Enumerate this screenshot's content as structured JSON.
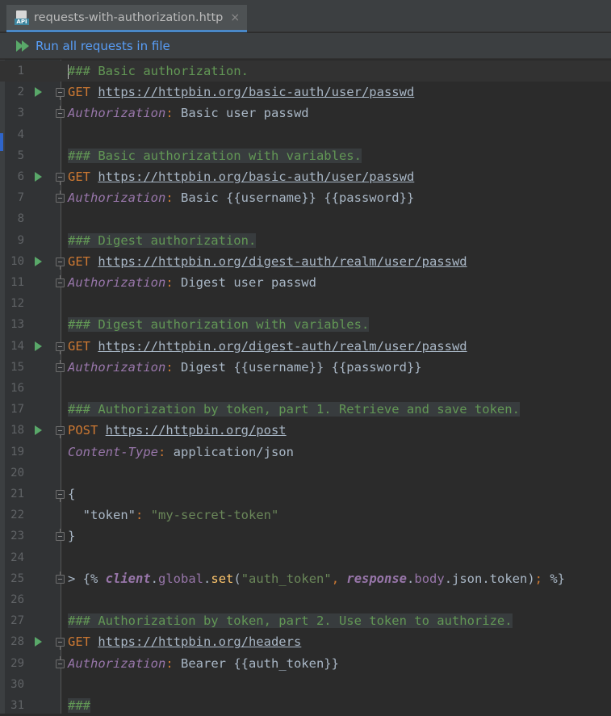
{
  "tab": {
    "title": "requests-with-authorization.http",
    "icon_badge": "API",
    "close_symbol": "×"
  },
  "toolbar": {
    "run_all_label": "Run all requests in file"
  },
  "lines": [
    {
      "n": "1",
      "parts": [
        [
          "c",
          "### Basic authorization."
        ]
      ],
      "comment_bg": false,
      "current": true
    },
    {
      "n": "2",
      "run": true,
      "fold": "open",
      "parts": [
        [
          "m",
          "GET"
        ],
        [
          "p",
          " "
        ],
        [
          "u",
          "https://httpbin.org/basic-auth/user/passwd"
        ]
      ]
    },
    {
      "n": "3",
      "fold": "end",
      "parts": [
        [
          "h",
          "Authorization"
        ],
        [
          "o",
          ":"
        ],
        [
          "p",
          " Basic user passwd"
        ]
      ]
    },
    {
      "n": "4",
      "parts": []
    },
    {
      "n": "5",
      "parts": [
        [
          "c",
          "### Basic authorization with variables."
        ]
      ],
      "comment_bg": true
    },
    {
      "n": "6",
      "run": true,
      "fold": "open",
      "parts": [
        [
          "m",
          "GET"
        ],
        [
          "p",
          " "
        ],
        [
          "u",
          "https://httpbin.org/basic-auth/user/passwd"
        ]
      ]
    },
    {
      "n": "7",
      "fold": "end",
      "parts": [
        [
          "h",
          "Authorization"
        ],
        [
          "o",
          ":"
        ],
        [
          "p",
          " Basic {{username}} {{password}}"
        ]
      ]
    },
    {
      "n": "8",
      "parts": []
    },
    {
      "n": "9",
      "parts": [
        [
          "c",
          "### Digest authorization."
        ]
      ],
      "comment_bg": true
    },
    {
      "n": "10",
      "run": true,
      "fold": "open",
      "parts": [
        [
          "m",
          "GET"
        ],
        [
          "p",
          " "
        ],
        [
          "u",
          "https://httpbin.org/digest-auth/realm/user/passwd"
        ]
      ]
    },
    {
      "n": "11",
      "fold": "end",
      "parts": [
        [
          "h",
          "Authorization"
        ],
        [
          "o",
          ":"
        ],
        [
          "p",
          " Digest user passwd"
        ]
      ]
    },
    {
      "n": "12",
      "parts": []
    },
    {
      "n": "13",
      "parts": [
        [
          "c",
          "### Digest authorization with variables."
        ]
      ],
      "comment_bg": true
    },
    {
      "n": "14",
      "run": true,
      "fold": "open",
      "parts": [
        [
          "m",
          "GET"
        ],
        [
          "p",
          " "
        ],
        [
          "u",
          "https://httpbin.org/digest-auth/realm/user/passwd"
        ]
      ]
    },
    {
      "n": "15",
      "fold": "end",
      "parts": [
        [
          "h",
          "Authorization"
        ],
        [
          "o",
          ":"
        ],
        [
          "p",
          " Digest {{username}} {{password}}"
        ]
      ]
    },
    {
      "n": "16",
      "parts": []
    },
    {
      "n": "17",
      "parts": [
        [
          "c",
          "### Authorization by token, part 1. Retrieve and save token."
        ]
      ],
      "comment_bg": true
    },
    {
      "n": "18",
      "run": true,
      "fold": "open",
      "parts": [
        [
          "m",
          "POST"
        ],
        [
          "p",
          " "
        ],
        [
          "u",
          "https://httpbin.org/post"
        ]
      ]
    },
    {
      "n": "19",
      "parts": [
        [
          "h",
          "Content-Type"
        ],
        [
          "o",
          ":"
        ],
        [
          "p",
          " application/json"
        ]
      ]
    },
    {
      "n": "20",
      "parts": []
    },
    {
      "n": "21",
      "fold": "open",
      "parts": [
        [
          "p",
          "{"
        ]
      ]
    },
    {
      "n": "22",
      "parts": [
        [
          "p",
          "  "
        ],
        [
          "k",
          "\"token\""
        ],
        [
          "o",
          ":"
        ],
        [
          "p",
          " "
        ],
        [
          "s",
          "\"my-secret-token\""
        ]
      ]
    },
    {
      "n": "23",
      "fold": "end",
      "parts": [
        [
          "p",
          "}"
        ]
      ]
    },
    {
      "n": "24",
      "parts": []
    },
    {
      "n": "25",
      "fold": "end",
      "parts": [
        [
          "p",
          "> {% "
        ],
        [
          "i",
          "client"
        ],
        [
          "p",
          "."
        ],
        [
          "v",
          "global"
        ],
        [
          "p",
          "."
        ],
        [
          "f",
          "set"
        ],
        [
          "p",
          "("
        ],
        [
          "s",
          "\"auth_token\""
        ],
        [
          "o",
          ", "
        ],
        [
          "i",
          "response"
        ],
        [
          "p",
          "."
        ],
        [
          "v",
          "body"
        ],
        [
          "p",
          ".json.token)"
        ],
        [
          "o",
          ";"
        ],
        [
          "p",
          " %}"
        ]
      ]
    },
    {
      "n": "26",
      "parts": []
    },
    {
      "n": "27",
      "parts": [
        [
          "c",
          "### Authorization by token, part 2. Use token to authorize."
        ]
      ],
      "comment_bg": true
    },
    {
      "n": "28",
      "run": true,
      "fold": "open",
      "parts": [
        [
          "m",
          "GET"
        ],
        [
          "p",
          " "
        ],
        [
          "u",
          "https://httpbin.org/headers"
        ]
      ]
    },
    {
      "n": "29",
      "fold": "end",
      "parts": [
        [
          "h",
          "Authorization"
        ],
        [
          "o",
          ":"
        ],
        [
          "p",
          " Bearer {{auth_token}}"
        ]
      ]
    },
    {
      "n": "30",
      "parts": []
    },
    {
      "n": "31",
      "parts": [
        [
          "c",
          "###"
        ]
      ],
      "comment_bg": true
    }
  ]
}
